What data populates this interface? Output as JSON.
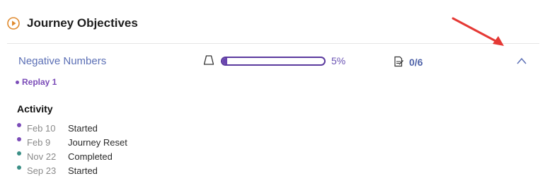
{
  "header": {
    "title": "Journey Objectives"
  },
  "objective": {
    "title": "Negative Numbers",
    "progress_percent": 5,
    "progress_label": "5%",
    "score": "0/6"
  },
  "replay": {
    "label": "Replay 1"
  },
  "activity": {
    "heading": "Activity",
    "items": [
      {
        "date": "Feb 10",
        "text": "Started",
        "color": "#7b4cb8"
      },
      {
        "date": "Feb 9",
        "text": "Journey Reset",
        "color": "#7b4cb8"
      },
      {
        "date": "Nov 22",
        "text": "Completed",
        "color": "#3b8f86"
      },
      {
        "date": "Sep 23",
        "text": "Started",
        "color": "#3b8f86"
      }
    ]
  },
  "colors": {
    "accent": "#5b6fb5",
    "progress": "#6a45b0",
    "play_icon": "#e08a2e",
    "annotation_arrow": "#e53935"
  }
}
